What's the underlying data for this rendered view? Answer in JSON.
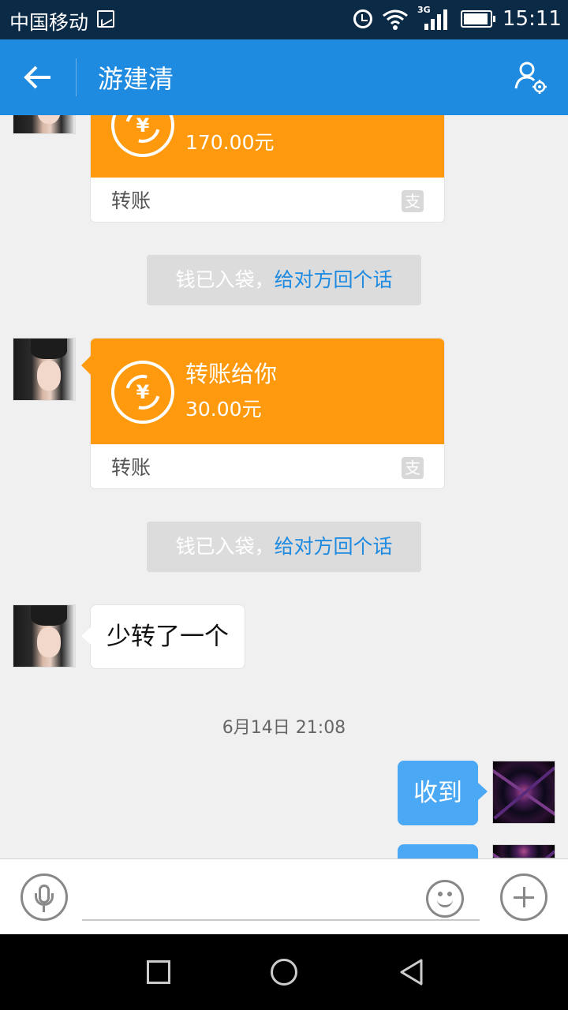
{
  "status_bar": {
    "carrier": "中国移动",
    "network": "3G",
    "time": "15:11"
  },
  "header": {
    "title": "游建清"
  },
  "messages": {
    "transfer1": {
      "amount": "170.00元",
      "footer": "转账"
    },
    "notice1": {
      "prefix": "钱已入袋，",
      "link": "给对方回个话"
    },
    "transfer2": {
      "label": "转账给你",
      "amount": "30.00元",
      "footer": "转账"
    },
    "notice2": {
      "prefix": "钱已入袋，",
      "link": "给对方回个话"
    },
    "text1": "少转了一个",
    "timestamp": "6月14日 21:08",
    "reply1": "收到"
  },
  "icons": {
    "transfer_symbol": "¥",
    "alipay_symbol": "支"
  },
  "colors": {
    "header": "#1e8ae0",
    "transfer": "#ff9a0e",
    "link": "#1e8ae0",
    "sent_bubble": "#4aa8f5"
  }
}
